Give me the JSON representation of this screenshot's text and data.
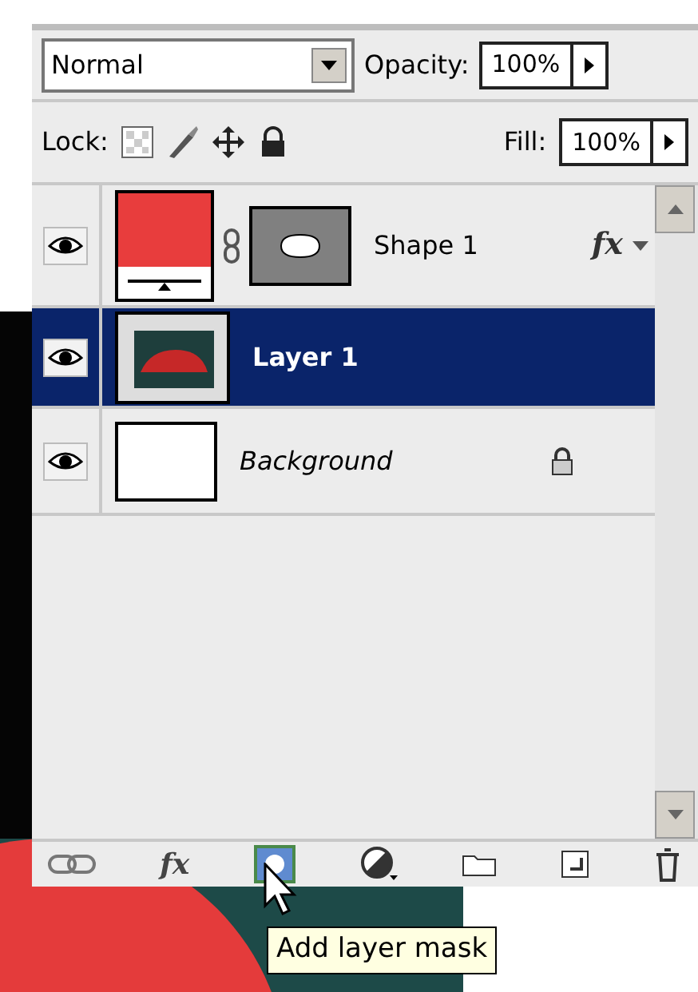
{
  "blend_mode": {
    "value": "Normal"
  },
  "opacity": {
    "label": "Opacity:",
    "value": "100%"
  },
  "lock": {
    "label": "Lock:"
  },
  "fill": {
    "label": "Fill:",
    "value": "100%"
  },
  "layers": [
    {
      "name": "Shape 1",
      "kind": "shape",
      "visible": true,
      "selected": false,
      "locked": false,
      "effects": "fx"
    },
    {
      "name": "Layer 1",
      "kind": "image",
      "visible": true,
      "selected": true,
      "locked": false
    },
    {
      "name": "Background",
      "kind": "background",
      "visible": true,
      "selected": false,
      "locked": true
    }
  ],
  "bottom_bar": {
    "effects": "fx"
  },
  "tooltip": "Add layer mask"
}
